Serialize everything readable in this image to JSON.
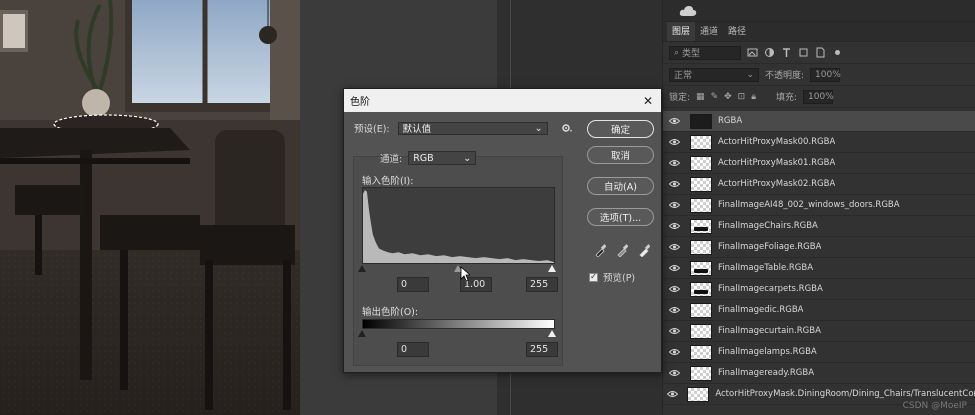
{
  "levels_dialog": {
    "title": "色阶",
    "close": "✕",
    "preset_label": "预设(E):",
    "preset_value": "默认值",
    "channel_label": "通道:",
    "channel_value": "RGB",
    "input_levels_label": "输入色阶(I):",
    "input_black": "0",
    "input_gamma": "1.00",
    "input_white": "255",
    "output_levels_label": "输出色阶(O):",
    "output_black": "0",
    "output_white": "255",
    "buttons": {
      "ok": "确定",
      "cancel": "取消",
      "auto": "自动(A)",
      "options": "选项(T)..."
    },
    "preview_label": "预览(P)",
    "preview_checked": true
  },
  "layers_panel": {
    "tabs": [
      "图层",
      "通道",
      "路径"
    ],
    "active_tab": 0,
    "filter_kind": "类型",
    "blend_mode": "正常",
    "opacity_label": "不透明度:",
    "opacity_value": "100%",
    "lock_label": "锁定:",
    "fill_label": "填充:",
    "fill_value": "100%",
    "layers": [
      {
        "name": "RGBA",
        "selected": true,
        "thumb": "dark"
      },
      {
        "name": "ActorHitProxyMask00.RGBA",
        "selected": false,
        "thumb": "transparent"
      },
      {
        "name": "ActorHitProxyMask01.RGBA",
        "selected": false,
        "thumb": "transparent"
      },
      {
        "name": "ActorHitProxyMask02.RGBA",
        "selected": false,
        "thumb": "transparent"
      },
      {
        "name": "FinalImageAI48_002_windows_doors.RGBA",
        "selected": false,
        "thumb": "transparent"
      },
      {
        "name": "FinalImageChairs.RGBA",
        "selected": false,
        "thumb": "content"
      },
      {
        "name": "FinalImageFoliage.RGBA",
        "selected": false,
        "thumb": "transparent"
      },
      {
        "name": "FinalImageTable.RGBA",
        "selected": false,
        "thumb": "content"
      },
      {
        "name": "FinalImagecarpets.RGBA",
        "selected": false,
        "thumb": "content"
      },
      {
        "name": "FinalImagedic.RGBA",
        "selected": false,
        "thumb": "transparent"
      },
      {
        "name": "FinalImagecurtain.RGBA",
        "selected": false,
        "thumb": "transparent"
      },
      {
        "name": "FinalImagelamps.RGBA",
        "selected": false,
        "thumb": "transparent"
      },
      {
        "name": "FinalImageready.RGBA",
        "selected": false,
        "thumb": "transparent"
      },
      {
        "name": "ActorHitProxyMask.DiningRoom/Dining_Chairs/TranslucentComponent",
        "selected": false,
        "thumb": "transparent"
      }
    ]
  },
  "watermark": "CSDN @MoeIP"
}
